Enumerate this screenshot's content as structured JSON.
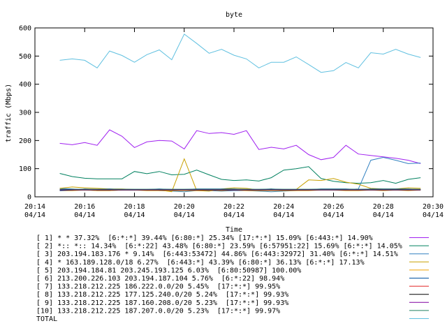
{
  "chart_data": {
    "type": "line",
    "title": "byte",
    "xlabel": "Time",
    "ylabel": "traffic (Mbps)",
    "ylim": [
      0,
      600
    ],
    "yticks": [
      0,
      100,
      200,
      300,
      400,
      500,
      600
    ],
    "xlim": [
      "20:14",
      "20:30"
    ],
    "xticks": [
      {
        "time": "20:14",
        "date": "04/14"
      },
      {
        "time": "20:16",
        "date": "04/14"
      },
      {
        "time": "20:18",
        "date": "04/14"
      },
      {
        "time": "20:20",
        "date": "04/14"
      },
      {
        "time": "20:22",
        "date": "04/14"
      },
      {
        "time": "20:24",
        "date": "04/14"
      },
      {
        "time": "20:26",
        "date": "04/14"
      },
      {
        "time": "20:28",
        "date": "04/14"
      },
      {
        "time": "20:30",
        "date": "04/14"
      }
    ],
    "x": [
      "20:15:00",
      "20:15:30",
      "20:16:00",
      "20:16:30",
      "20:17:00",
      "20:17:30",
      "20:18:00",
      "20:18:30",
      "20:19:00",
      "20:19:30",
      "20:20:00",
      "20:20:30",
      "20:21:00",
      "20:21:30",
      "20:22:00",
      "20:22:30",
      "20:23:00",
      "20:23:30",
      "20:24:00",
      "20:24:30",
      "20:25:00",
      "20:25:30",
      "20:26:00",
      "20:26:30",
      "20:27:00",
      "20:27:30",
      "20:28:00",
      "20:28:30",
      "20:29:00",
      "20:29:30"
    ],
    "series": [
      {
        "name": "[ 1] * * 37.32%  [6:*:*] 39.44% [6:80:*] 25.34% [17:*:*] 15.09% [6:443:*] 14.90%",
        "color": "#a020f0",
        "values": [
          190,
          185,
          193,
          183,
          238,
          215,
          175,
          195,
          200,
          198,
          170,
          235,
          225,
          228,
          222,
          235,
          168,
          176,
          170,
          183,
          150,
          132,
          140,
          183,
          152,
          147,
          142,
          137,
          130,
          118
        ]
      },
      {
        "name": "[ 2] *:: *:: 14.34%  [6:*:22] 43.48% [6:80:*] 23.59% [6:57951:22] 15.69% [6:*:*] 14.05%",
        "color": "#00805f",
        "values": [
          83,
          72,
          66,
          64,
          64,
          64,
          90,
          82,
          90,
          78,
          80,
          95,
          78,
          62,
          58,
          60,
          56,
          68,
          95,
          100,
          107,
          65,
          55,
          50,
          48,
          50,
          58,
          48,
          62,
          68
        ]
      },
      {
        "name": "[ 3] 203.194.183.176 * 9.14%  [6:443:53472] 44.86% [6:443:32972] 31.40% [6:*:*] 14.51%",
        "color": "#3080c0",
        "values": [
          30,
          28,
          25,
          22,
          22,
          24,
          24,
          26,
          22,
          20,
          18,
          22,
          22,
          20,
          22,
          22,
          20,
          18,
          20,
          22,
          24,
          25,
          26,
          25,
          28,
          130,
          140,
          130,
          118,
          120
        ]
      },
      {
        "name": "[ 4] * 163.189.128.0/18 6.27%  [6:443:*] 43.39% [6:80:*] 36.13% [6:*:*] 17.13%",
        "color": "#c8a000",
        "values": [
          30,
          35,
          32,
          30,
          28,
          28,
          26,
          24,
          24,
          18,
          135,
          22,
          20,
          28,
          32,
          30,
          24,
          28,
          22,
          26,
          60,
          58,
          65,
          52,
          45,
          30,
          28,
          28,
          32,
          30
        ]
      },
      {
        "name": "[ 5] 203.194.184.81 203.245.193.125 6.03%  [6:80:50987] 100.00%",
        "color": "#f0a000",
        "values": [
          22,
          22,
          24,
          22,
          22,
          24,
          24,
          22,
          22,
          22,
          22,
          22,
          24,
          22,
          24,
          22,
          22,
          22,
          22,
          22,
          22,
          24,
          24,
          22,
          22,
          24,
          22,
          24,
          22,
          24
        ]
      },
      {
        "name": "[ 6] 213.200.226.103 203.194.187.104 5.76%  [6:*:22] 98.94%",
        "color": "#0050a0",
        "values": [
          22,
          24,
          28,
          26,
          28,
          26,
          26,
          26,
          28,
          26,
          26,
          28,
          28,
          28,
          28,
          26,
          26,
          28,
          26,
          26,
          26,
          28,
          28,
          28,
          26,
          28,
          28,
          28,
          28,
          26
        ]
      },
      {
        "name": "[ 7] 133.218.212.225 186.222.0.0/20 5.45%  [17:*:*] 99.95%",
        "color": "#e02020",
        "values": [
          26,
          26,
          26,
          26,
          26,
          26,
          26,
          26,
          26,
          26,
          26,
          26,
          26,
          26,
          26,
          26,
          26,
          26,
          26,
          26,
          26,
          26,
          26,
          26,
          26,
          26,
          26,
          26,
          26,
          26
        ]
      },
      {
        "name": "[ 8] 133.218.212.225 177.125.240.0/20 5.24%  [17:*:*] 99.93%",
        "color": "#000000",
        "values": [
          24,
          24,
          24,
          24,
          24,
          24,
          24,
          24,
          24,
          24,
          24,
          24,
          24,
          24,
          24,
          24,
          24,
          24,
          24,
          24,
          24,
          24,
          24,
          24,
          24,
          24,
          24,
          24,
          24,
          24
        ]
      },
      {
        "name": "[ 9] 133.218.212.225 187.160.208.0/20 5.23%  [17:*:*] 99.93%",
        "color": "#8000a0",
        "values": [
          25,
          25,
          25,
          25,
          25,
          25,
          25,
          25,
          25,
          25,
          25,
          25,
          25,
          25,
          25,
          25,
          25,
          25,
          25,
          25,
          25,
          25,
          25,
          25,
          25,
          25,
          25,
          25,
          25,
          25
        ]
      },
      {
        "name": "[10] 133.218.212.225 187.207.0.0/20 5.23%  [17:*:*] 99.97%",
        "color": "#208060",
        "values": [
          27,
          27,
          27,
          27,
          27,
          27,
          27,
          27,
          27,
          27,
          27,
          27,
          27,
          27,
          27,
          27,
          27,
          27,
          27,
          27,
          27,
          27,
          27,
          27,
          27,
          27,
          27,
          27,
          27,
          27
        ]
      },
      {
        "name": "TOTAL",
        "color": "#60c0e0",
        "values": [
          485,
          490,
          485,
          458,
          518,
          502,
          478,
          505,
          522,
          487,
          578,
          545,
          510,
          524,
          503,
          490,
          458,
          478,
          478,
          497,
          470,
          442,
          448,
          477,
          458,
          512,
          507,
          524,
          507,
          495
        ]
      }
    ],
    "grid": false,
    "legend_placement": "bottom"
  }
}
